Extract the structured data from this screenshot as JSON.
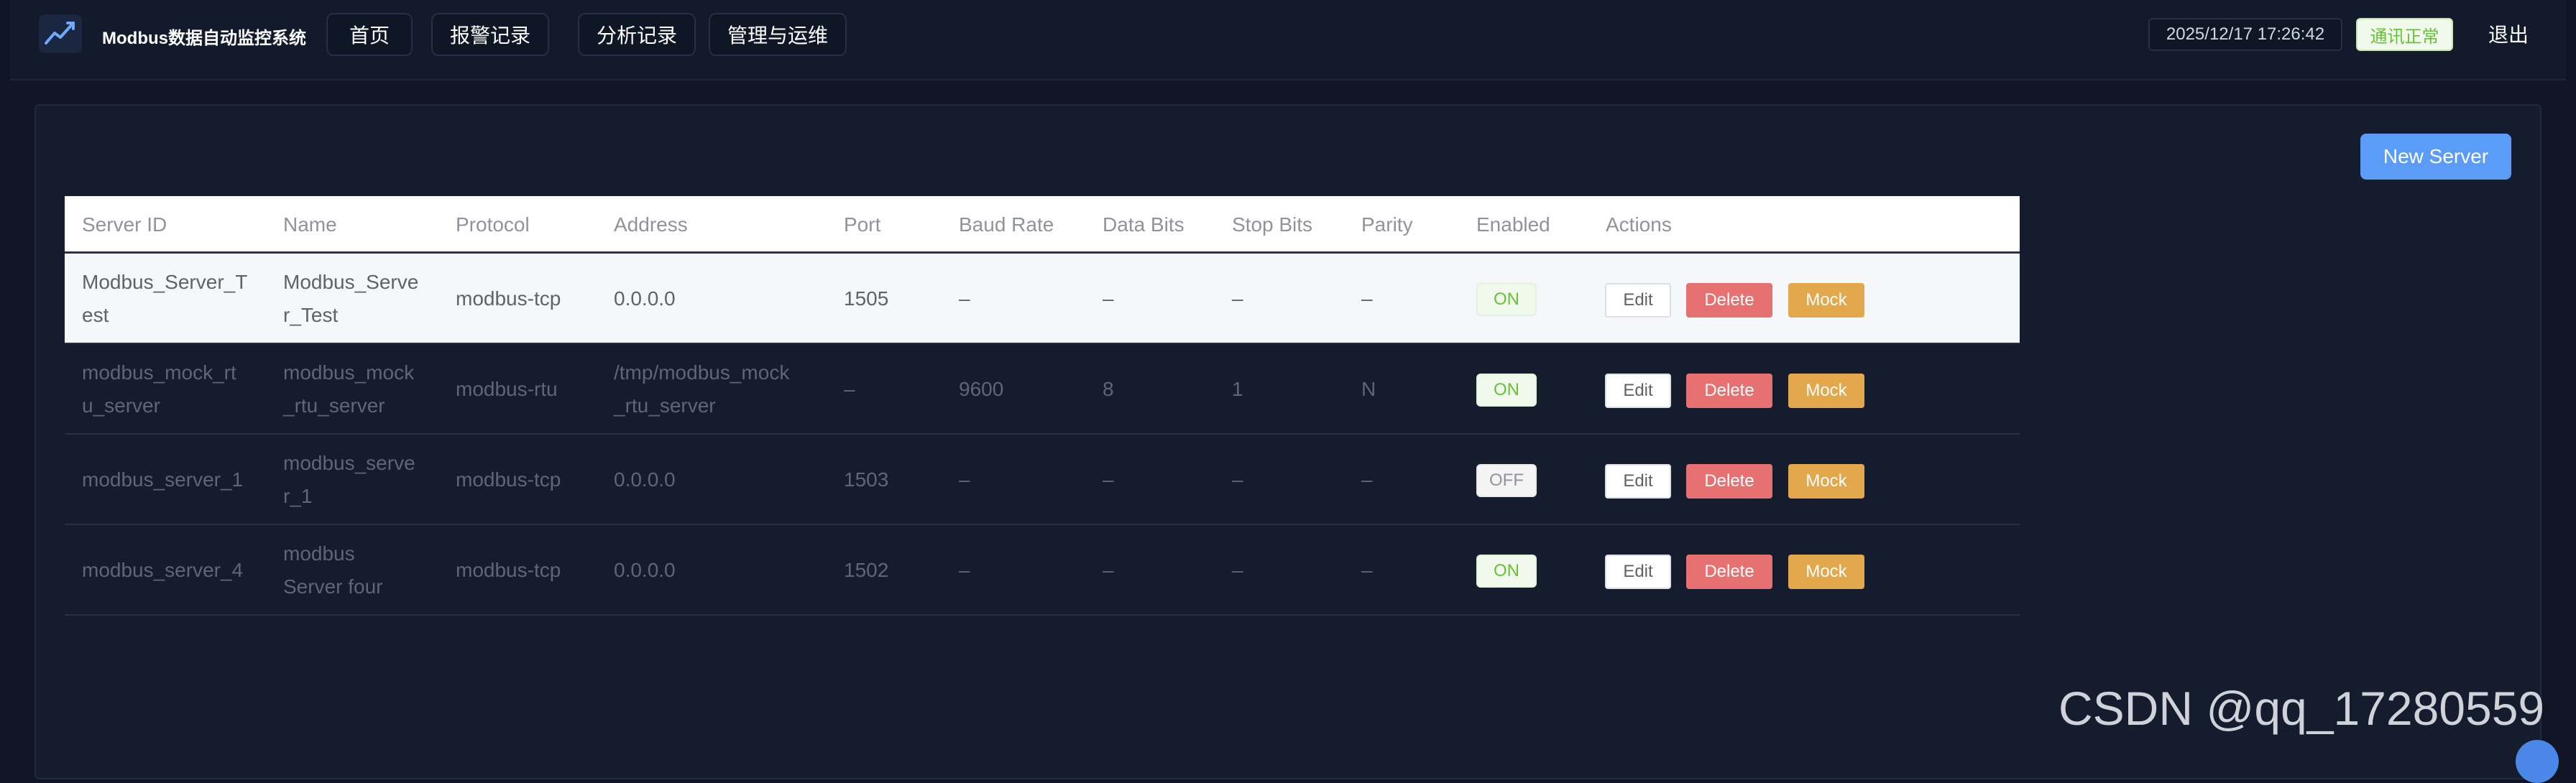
{
  "header": {
    "app_title": "Modbus数据自动监控系统",
    "logo_icon": "line-chart-icon",
    "nav": [
      {
        "label": "首页"
      },
      {
        "label": "报警记录"
      },
      {
        "label": "分析记录"
      },
      {
        "label": "管理与运维"
      }
    ],
    "datetime": "2025/12/17 17:26:42",
    "status": "通讯正常",
    "logout": "退出"
  },
  "toolbar": {
    "new_server_label": "New Server"
  },
  "table": {
    "columns": [
      "Server ID",
      "Name",
      "Protocol",
      "Address",
      "Port",
      "Baud Rate",
      "Data Bits",
      "Stop Bits",
      "Parity",
      "Enabled",
      "Actions"
    ],
    "action_labels": {
      "edit": "Edit",
      "delete": "Delete",
      "mock": "Mock"
    },
    "rows": [
      {
        "id_lines": [
          "Modbus_Server_T",
          "est"
        ],
        "name_lines": [
          "Modbus_Serve",
          "r_Test"
        ],
        "protocol": "modbus-tcp",
        "address_lines": [
          "0.0.0.0"
        ],
        "port": "1505",
        "baud_rate": "–",
        "data_bits": "–",
        "stop_bits": "–",
        "parity": "–",
        "enabled": "ON"
      },
      {
        "id_lines": [
          "modbus_mock_rt",
          "u_server"
        ],
        "name_lines": [
          "modbus_mock",
          "_rtu_server"
        ],
        "protocol": "modbus-rtu",
        "address_lines": [
          "/tmp/modbus_mock",
          "_rtu_server"
        ],
        "port": "–",
        "baud_rate": "9600",
        "data_bits": "8",
        "stop_bits": "1",
        "parity": "N",
        "enabled": "ON"
      },
      {
        "id_lines": [
          "modbus_server_1"
        ],
        "name_lines": [
          "modbus_serve",
          "r_1"
        ],
        "protocol": "modbus-tcp",
        "address_lines": [
          "0.0.0.0"
        ],
        "port": "1503",
        "baud_rate": "–",
        "data_bits": "–",
        "stop_bits": "–",
        "parity": "–",
        "enabled": "OFF"
      },
      {
        "id_lines": [
          "modbus_server_4"
        ],
        "name_lines": [
          "modbus",
          "Server four"
        ],
        "protocol": "modbus-tcp",
        "address_lines": [
          "0.0.0.0"
        ],
        "port": "1502",
        "baud_rate": "–",
        "data_bits": "–",
        "stop_bits": "–",
        "parity": "–",
        "enabled": "ON"
      }
    ]
  },
  "watermark": "CSDN @qq_17280559"
}
